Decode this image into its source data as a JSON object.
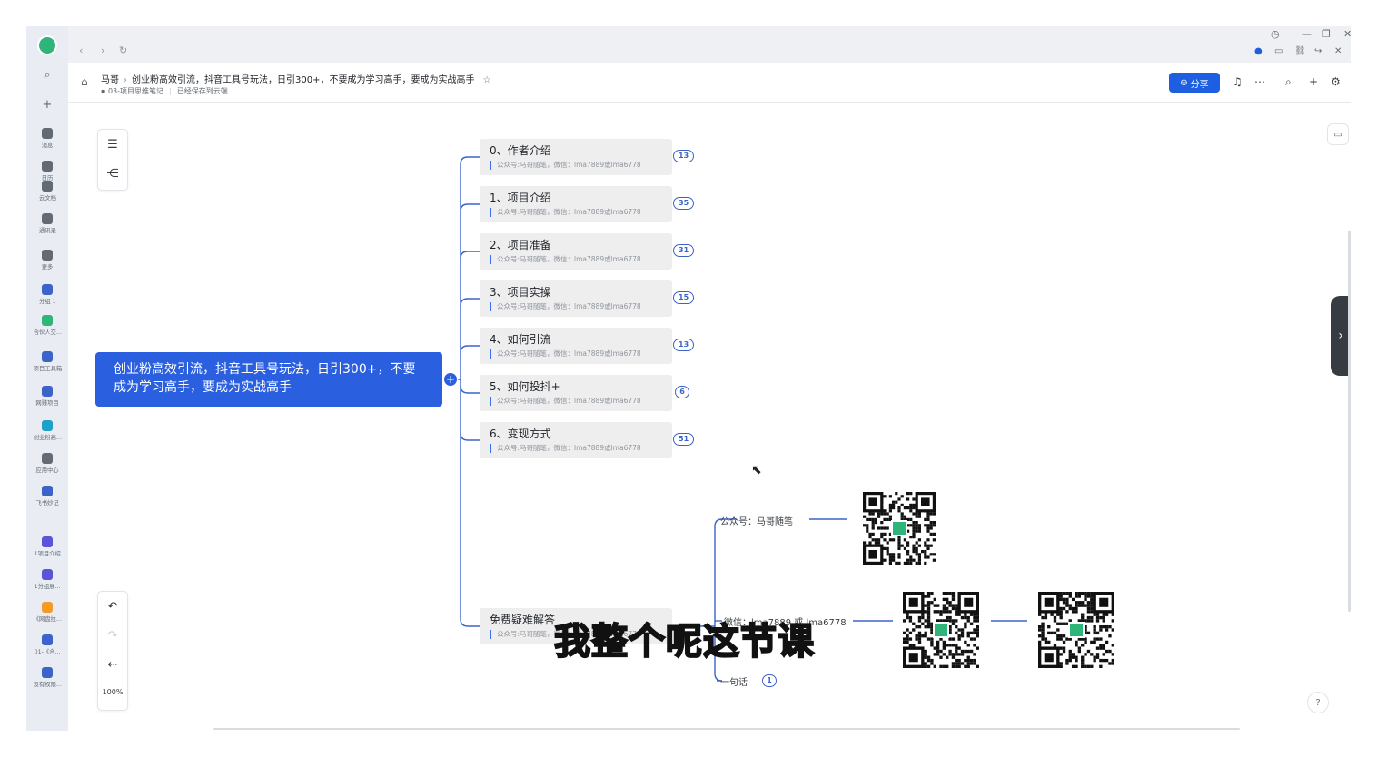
{
  "rail": {
    "items": [
      {
        "label": "消息",
        "icon": "chat-icon",
        "color": "#646a73"
      },
      {
        "label": "日历",
        "icon": "calendar-icon",
        "color": "#646a73"
      },
      {
        "label": "云文档",
        "icon": "doc-icon",
        "color": "#646a73"
      },
      {
        "label": "通讯录",
        "icon": "contacts-icon",
        "color": "#646a73"
      },
      {
        "label": "更多",
        "icon": "more-apps-icon",
        "color": "#646a73"
      },
      {
        "label": "分组 1",
        "icon": "group-icon",
        "color": "#3b63c8"
      },
      {
        "label": "合伙人交...",
        "icon": "grid-app-icon",
        "color": "#2fb57a"
      },
      {
        "label": "项目工具箱",
        "icon": "grid-app-icon",
        "color": "#3b63c8"
      },
      {
        "label": "网赚项目",
        "icon": "grid-app-icon",
        "color": "#3b63c8"
      },
      {
        "label": "创业粉高...",
        "icon": "mindmap-app-icon",
        "color": "#1fa0c8"
      },
      {
        "label": "应用中心",
        "icon": "app-center-icon",
        "color": "#646a73"
      },
      {
        "label": "飞书妙记",
        "icon": "minutes-icon",
        "color": "#3b63c8"
      },
      {
        "label": "1项目介绍",
        "icon": "minutes-icon",
        "color": "#5b54d6"
      },
      {
        "label": "1分组展...",
        "icon": "minutes-icon",
        "color": "#5b54d6"
      },
      {
        "label": "《网盘拉...",
        "icon": "folder-app-icon",
        "color": "#f39a2b"
      },
      {
        "label": "01-《合...",
        "icon": "doc-app-icon",
        "color": "#3b63c8"
      },
      {
        "label": "没有权限...",
        "icon": "doc-app-icon",
        "color": "#3b63c8"
      }
    ]
  },
  "header": {
    "crumb_home": "马哥",
    "doc_title": "创业粉高效引流，抖音工具号玩法，日引300+，不要成为学习高手，要成为实战高手",
    "folder": "03-项目思维笔记",
    "save_status": "已经保存到云端",
    "share_label": "分享"
  },
  "zoom": "100%",
  "mindmap": {
    "root": "创业粉高效引流，抖音工具号玩法，日引300+，不要成为学习高手，要成为实战高手",
    "topics": [
      {
        "title": "0、作者介绍",
        "note": "公众号:马哥随笔，微信：lma7889或lma6778",
        "count": "13"
      },
      {
        "title": "1、项目介绍",
        "note": "公众号:马哥随笔，微信：lma7889或lma6778",
        "count": "35"
      },
      {
        "title": "2、项目准备",
        "note": "公众号:马哥随笔，微信：lma7889或lma6778",
        "count": "31"
      },
      {
        "title": "3、项目实操",
        "note": "公众号:马哥随笔，微信：lma7889或lma6778",
        "count": "15"
      },
      {
        "title": "4、如何引流",
        "note": "公众号:马哥随笔，微信：lma7889或lma6778",
        "count": "13"
      },
      {
        "title": "5、如何投抖+",
        "note": "公众号:马哥随笔，微信：lma7889或lma6778",
        "count": "6"
      },
      {
        "title": "6、变现方式",
        "note": "公众号:马哥随笔，微信：lma7889或lma6778",
        "count": "51"
      }
    ],
    "faq": {
      "title": "免费疑难解答",
      "note": "公众号:马哥随笔，微信：lma7889或lma6778",
      "children": [
        {
          "label": "公众号：马哥随笔"
        },
        {
          "label": "微信：lma7889 或 lma6778"
        },
        {
          "label": "一句话",
          "count": "1"
        }
      ]
    }
  },
  "caption": "我整个呢这节课",
  "colors": {
    "accent": "#2a5fe0",
    "line": "#3b63c8",
    "rail": "#e9edf3"
  }
}
